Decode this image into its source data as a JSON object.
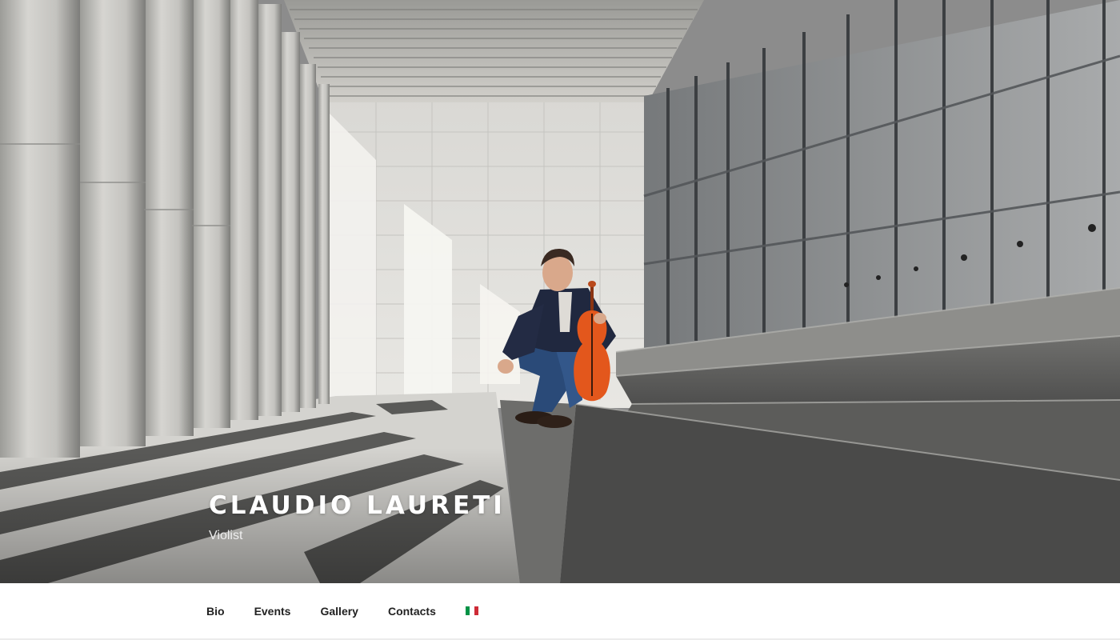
{
  "hero": {
    "title": "CLAUDIO LAURETI",
    "subtitle": "Violist"
  },
  "nav": {
    "items": [
      {
        "label": "Bio"
      },
      {
        "label": "Events"
      },
      {
        "label": "Gallery"
      },
      {
        "label": "Contacts"
      }
    ],
    "language_flag": {
      "icon": "italy-flag-icon",
      "colors": [
        "#009246",
        "#ffffff",
        "#ce2b37"
      ]
    }
  }
}
